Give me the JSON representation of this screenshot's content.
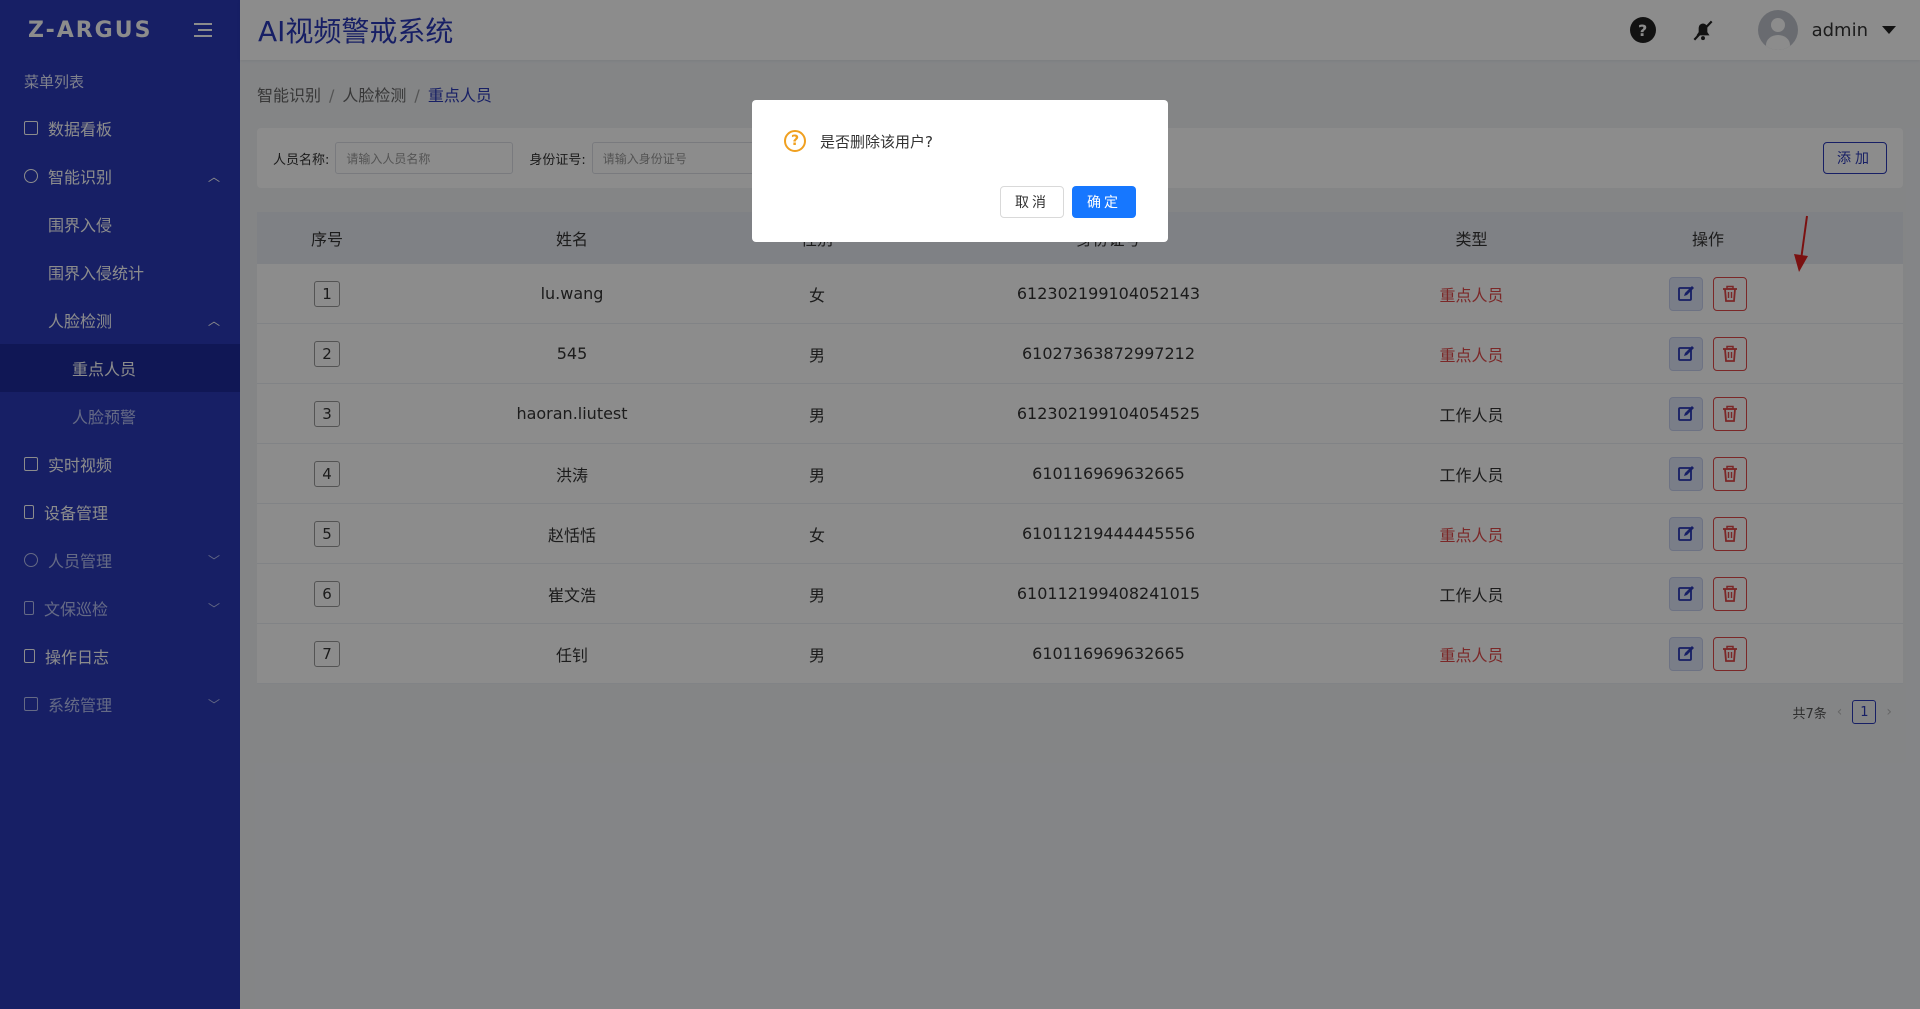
{
  "app": {
    "logo": "Z-ARGUS",
    "title": "AI视频警戒系统"
  },
  "header": {
    "help_icon": "question-circle-icon",
    "bell_icon": "bell-off-icon",
    "username": "admin"
  },
  "sidebar": {
    "menu_header": "菜单列表",
    "items": [
      {
        "label": "数据看板",
        "icon": "chart-icon",
        "level": 0
      },
      {
        "label": "智能识别",
        "icon": "alarm-icon",
        "level": 0,
        "expanded": true
      },
      {
        "label": "围界入侵",
        "level": 1
      },
      {
        "label": "围界入侵统计",
        "level": 1
      },
      {
        "label": "人脸检测",
        "level": 1,
        "expanded": true
      },
      {
        "label": "重点人员",
        "level": 2,
        "active": true
      },
      {
        "label": "人脸预警",
        "level": 2
      },
      {
        "label": "实时视频",
        "icon": "play-icon",
        "level": 0
      },
      {
        "label": "设备管理",
        "icon": "device-icon",
        "level": 0
      },
      {
        "label": "人员管理",
        "icon": "user-icon",
        "level": 0
      },
      {
        "label": "文保巡检",
        "icon": "hourglass-icon",
        "level": 0
      },
      {
        "label": "操作日志",
        "icon": "log-icon",
        "level": 0
      },
      {
        "label": "系统管理",
        "icon": "list-icon",
        "level": 0
      }
    ]
  },
  "breadcrumb": [
    "智能识别",
    "人脸检测",
    "重点人员"
  ],
  "filters": {
    "name_label": "人员名称:",
    "name_placeholder": "请输入人员名称",
    "id_label": "身份证号:",
    "id_placeholder": "请输入身份证号",
    "add_label": "添加"
  },
  "table": {
    "columns": [
      "序号",
      "姓名",
      "性别",
      "身份证号",
      "类型",
      "操作"
    ],
    "rows": [
      {
        "idx": "1",
        "name": "lu.wang",
        "gender": "女",
        "id": "612302199104052143",
        "type": "重点人员"
      },
      {
        "idx": "2",
        "name": "545",
        "gender": "男",
        "id": "61027363872997212",
        "type": "重点人员"
      },
      {
        "idx": "3",
        "name": "haoran.liutest",
        "gender": "男",
        "id": "612302199104054525",
        "type": "工作人员"
      },
      {
        "idx": "4",
        "name": "洪涛",
        "gender": "男",
        "id": "610116969632665",
        "type": "工作人员"
      },
      {
        "idx": "5",
        "name": "赵恬恬",
        "gender": "女",
        "id": "61011219444445556",
        "type": "重点人员"
      },
      {
        "idx": "6",
        "name": "崔文浩",
        "gender": "男",
        "id": "610112199408241015",
        "type": "工作人员"
      },
      {
        "idx": "7",
        "name": "任钊",
        "gender": "男",
        "id": "610116969632665",
        "type": "重点人员"
      }
    ]
  },
  "pagination": {
    "total": "共7条",
    "current": "1"
  },
  "dialog": {
    "message": "是否删除该用户?",
    "cancel": "取消",
    "confirm": "确定"
  },
  "colors": {
    "primary": "#2a39b8",
    "danger": "#e04a4a",
    "confirm": "#1677ff"
  }
}
